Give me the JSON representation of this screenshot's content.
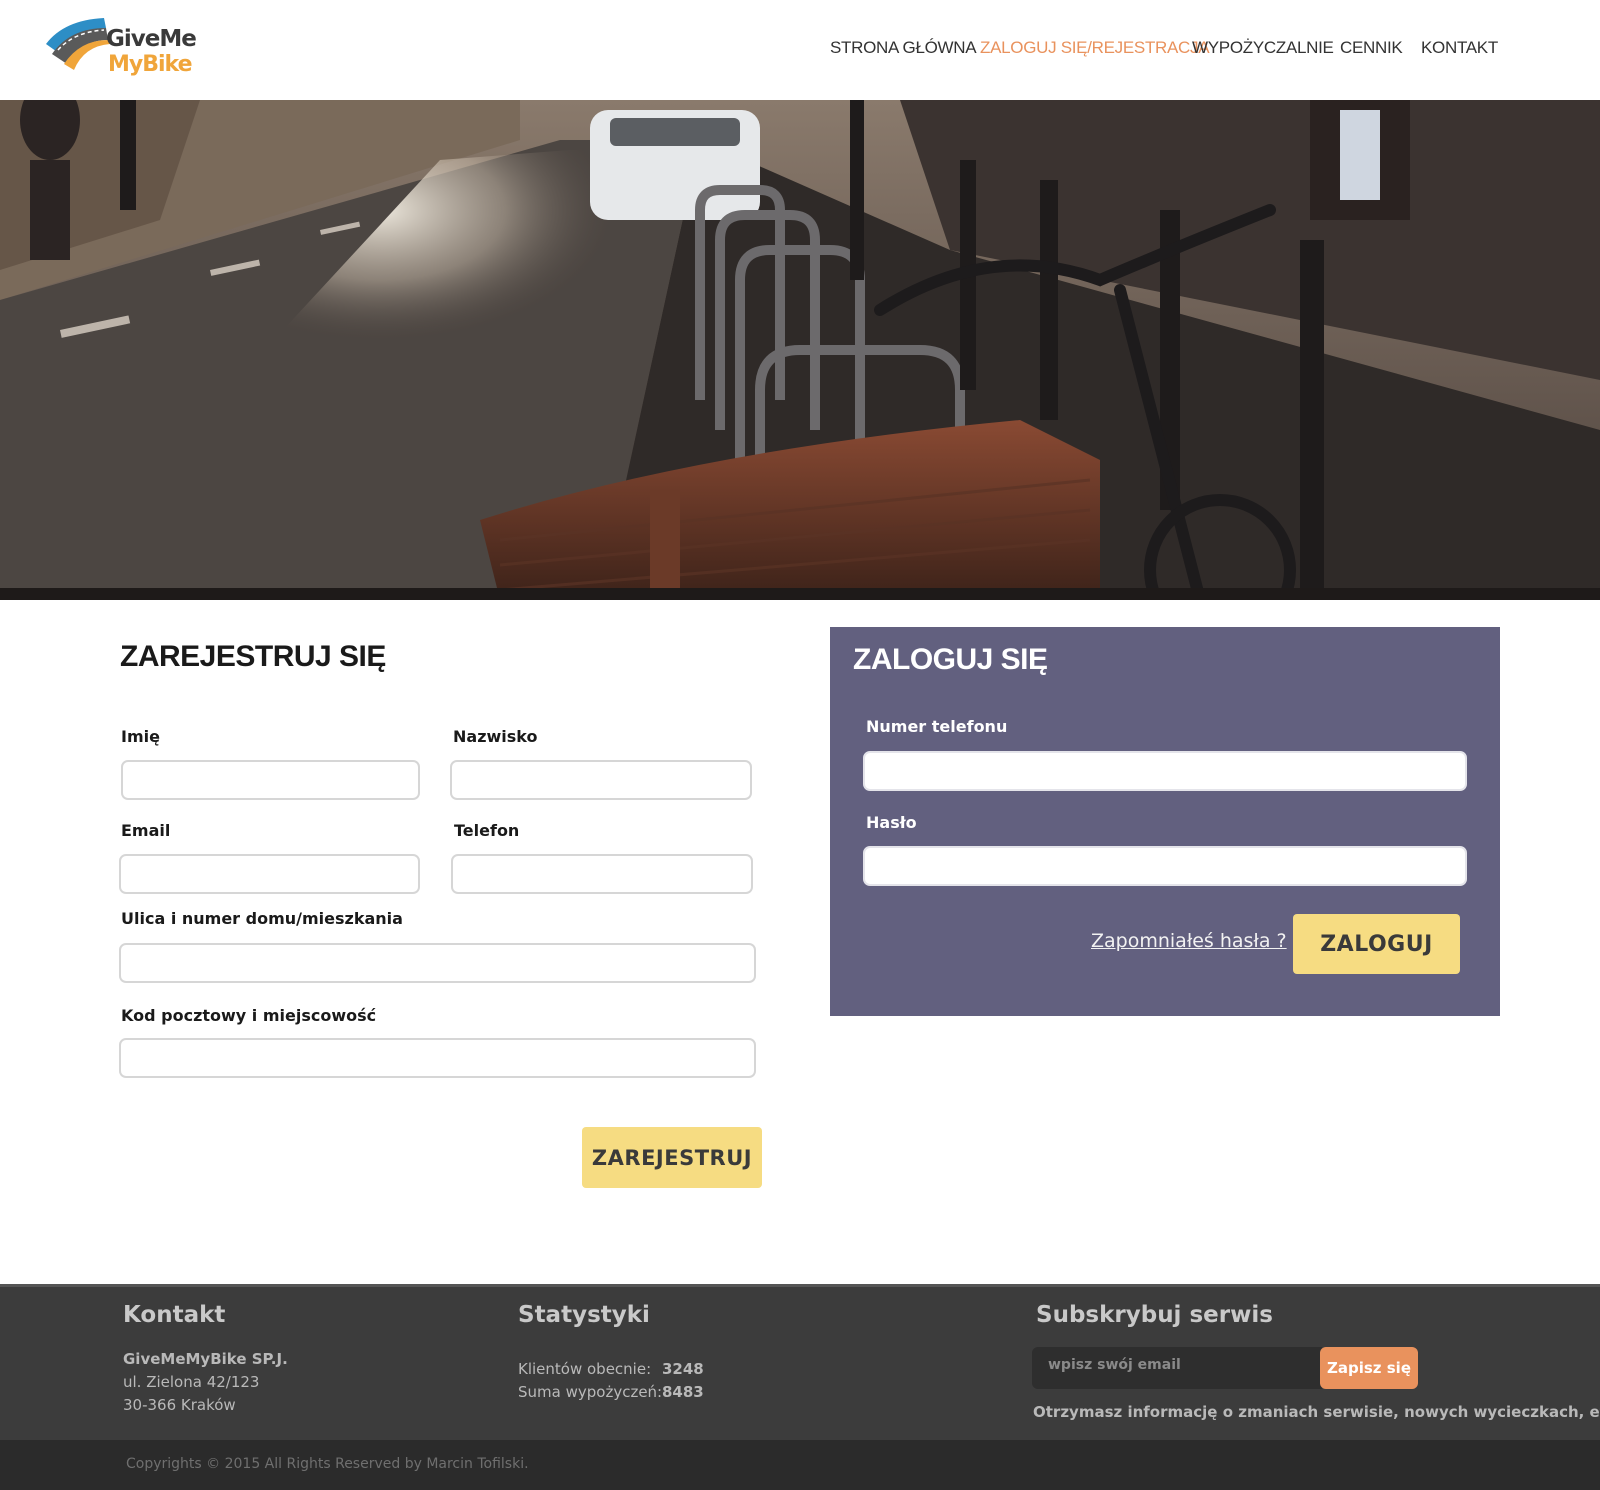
{
  "brand": {
    "line1": "GiveMe",
    "line2": "MyBike"
  },
  "nav": {
    "items": [
      {
        "label": "STRONA GŁÓWNA"
      },
      {
        "label": "ZALOGUJ SIĘ/REJESTRACJA"
      },
      {
        "label": "WYPOŻYCZALNIE"
      },
      {
        "label": "CENNIK"
      },
      {
        "label": "KONTAKT"
      }
    ],
    "active_color": "#e9925d"
  },
  "register": {
    "title": "ZAREJESTRUJ SIĘ",
    "first_name_label": "Imię",
    "last_name_label": "Nazwisko",
    "email_label": "Email",
    "phone_label": "Telefon",
    "street_label": "Ulica i numer domu/mieszkania",
    "postal_label": "Kod pocztowy i miejscowość",
    "first_name_value": "",
    "last_name_value": "",
    "email_value": "",
    "phone_value": "",
    "street_value": "",
    "postal_value": "",
    "submit_label": "ZAREJESTRUJ"
  },
  "login": {
    "title": "ZALOGUJ SIĘ",
    "phone_label": "Numer telefonu",
    "password_label": "Hasło",
    "phone_value": "",
    "password_value": "",
    "forgot_label": "Zapomniałeś hasła ?",
    "submit_label": "ZALOGUJ",
    "panel_color": "#62607f"
  },
  "footer": {
    "contact": {
      "title": "Kontakt",
      "company": "GiveMeMyBike SP.J.",
      "street": "ul. Zielona 42/123",
      "city": "30-366 Kraków"
    },
    "stats": {
      "title": "Statystyki",
      "clients_label": "Klientów obecnie:",
      "clients_value": "3248",
      "rentals_label": "Suma wypożyczeń:",
      "rentals_value": "8483"
    },
    "subscribe": {
      "title": "Subskrybuj serwis",
      "placeholder": "wpisz swój email",
      "button_label": "Zapisz się",
      "note": "Otrzymasz informację o zmaniach serwisie, nowych wycieczkach, etc."
    },
    "copyright": "Copyrights © 2015 All Rights Reserved by Marcin Tofilski."
  },
  "colors": {
    "accent_yellow": "#f6dc82",
    "accent_orange": "#e9925d",
    "footer_bg": "#3c3c3c"
  }
}
